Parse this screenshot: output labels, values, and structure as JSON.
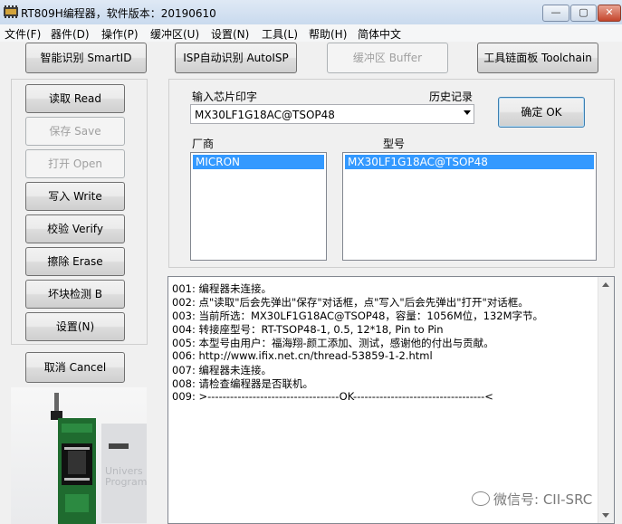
{
  "window": {
    "title": "RT809H编程器，软件版本：20190610",
    "minimize": "—",
    "maximize": "▢",
    "close": "✕"
  },
  "menu": [
    "文件(F)",
    "器件(D)",
    "操作(P)",
    "缓冲区(U)",
    "设置(N)",
    "工具(L)",
    "帮助(H)",
    "简体中文"
  ],
  "toolbar": {
    "smart_id": "智能识别 SmartID",
    "isp_auto": "ISP自动识别 AutoISP",
    "buffer": "缓冲区 Buffer",
    "toolchain": "工具链面板 Toolchain"
  },
  "left_panel": {
    "read": "读取 Read",
    "save": "保存 Save",
    "open": "打开 Open",
    "write": "写入 Write",
    "verify": "校验 Verify",
    "erase": "擦除 Erase",
    "bad_block": "坏块检测 B",
    "settings": "设置(N)",
    "cancel": "取消 Cancel"
  },
  "chip_panel": {
    "input_label": "输入芯片印字",
    "history_label": "历史记录",
    "chip_value": "MX30LF1G18AC@TSOP48",
    "ok_button": "确定 OK",
    "vendor_label": "厂商",
    "model_label": "型号",
    "vendors": [
      "MICRON"
    ],
    "models": [
      "MX30LF1G18AC@TSOP48"
    ]
  },
  "log": [
    "001: 编程器未连接。",
    "002: 点\"读取\"后会先弹出\"保存\"对话框，点\"写入\"后会先弹出\"打开\"对话框。",
    "003: 当前所选：MX30LF1G18AC@TSOP48，容量：1056M位，132M字节。",
    "004: 转接座型号：RT-TSOP48-1, 0.5, 12*18, Pin to Pin",
    "005: 本型号由用户：福海翔-颜工添加、测试，感谢他的付出与贡献。",
    "006: http://www.ifix.net.cn/thread-53859-1-2.html",
    "007: 编程器未连接。",
    "008: 请检查编程器是否联机。",
    "009: >-----------------------------------OK-----------------------------------<"
  ],
  "photo": {
    "caption_line1": "Univers",
    "caption_line2": "Programm"
  },
  "watermark": "微信号: CII-SRC",
  "colors": {
    "selection": "#3399ff",
    "window_bg": "#f0f0f0",
    "titlebar": "#c9daee"
  }
}
